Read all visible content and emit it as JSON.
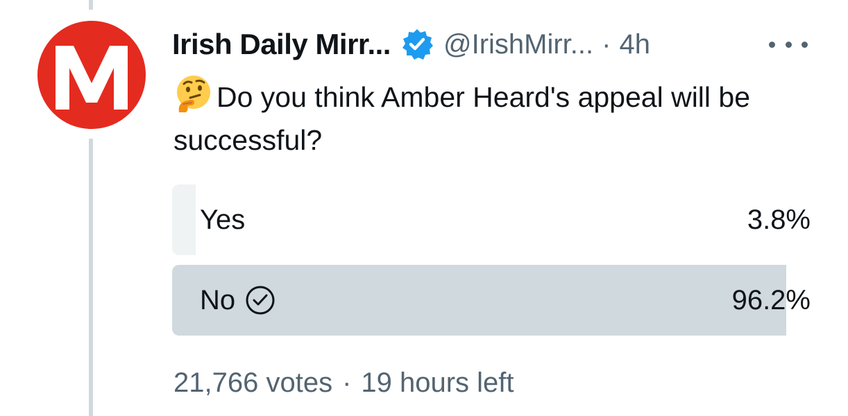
{
  "tweet": {
    "author": {
      "display_name": "Irish Daily Mirr...",
      "handle": "@IrishMirr...",
      "verified": true,
      "avatar_letter": "M",
      "avatar_color": "#e42b20"
    },
    "separator": "·",
    "time": "4h",
    "emoji": "thinking-face",
    "text": "Do you think Amber Heard's appeal will be successful?",
    "poll": {
      "options": [
        {
          "label": "Yes",
          "percent": "3.8%",
          "value": 3.8,
          "selected": false
        },
        {
          "label": "No",
          "percent": "96.2%",
          "value": 96.2,
          "selected": true
        }
      ],
      "votes": "21,766 votes",
      "separator": "·",
      "time_left": "19 hours left"
    }
  },
  "colors": {
    "text": "#0f1419",
    "secondary": "#536471",
    "verified_blue": "#1d9bf0",
    "bar_winner": "#cfd9de",
    "bar_other": "#eff3f4",
    "thread_line": "#cfd9de"
  }
}
